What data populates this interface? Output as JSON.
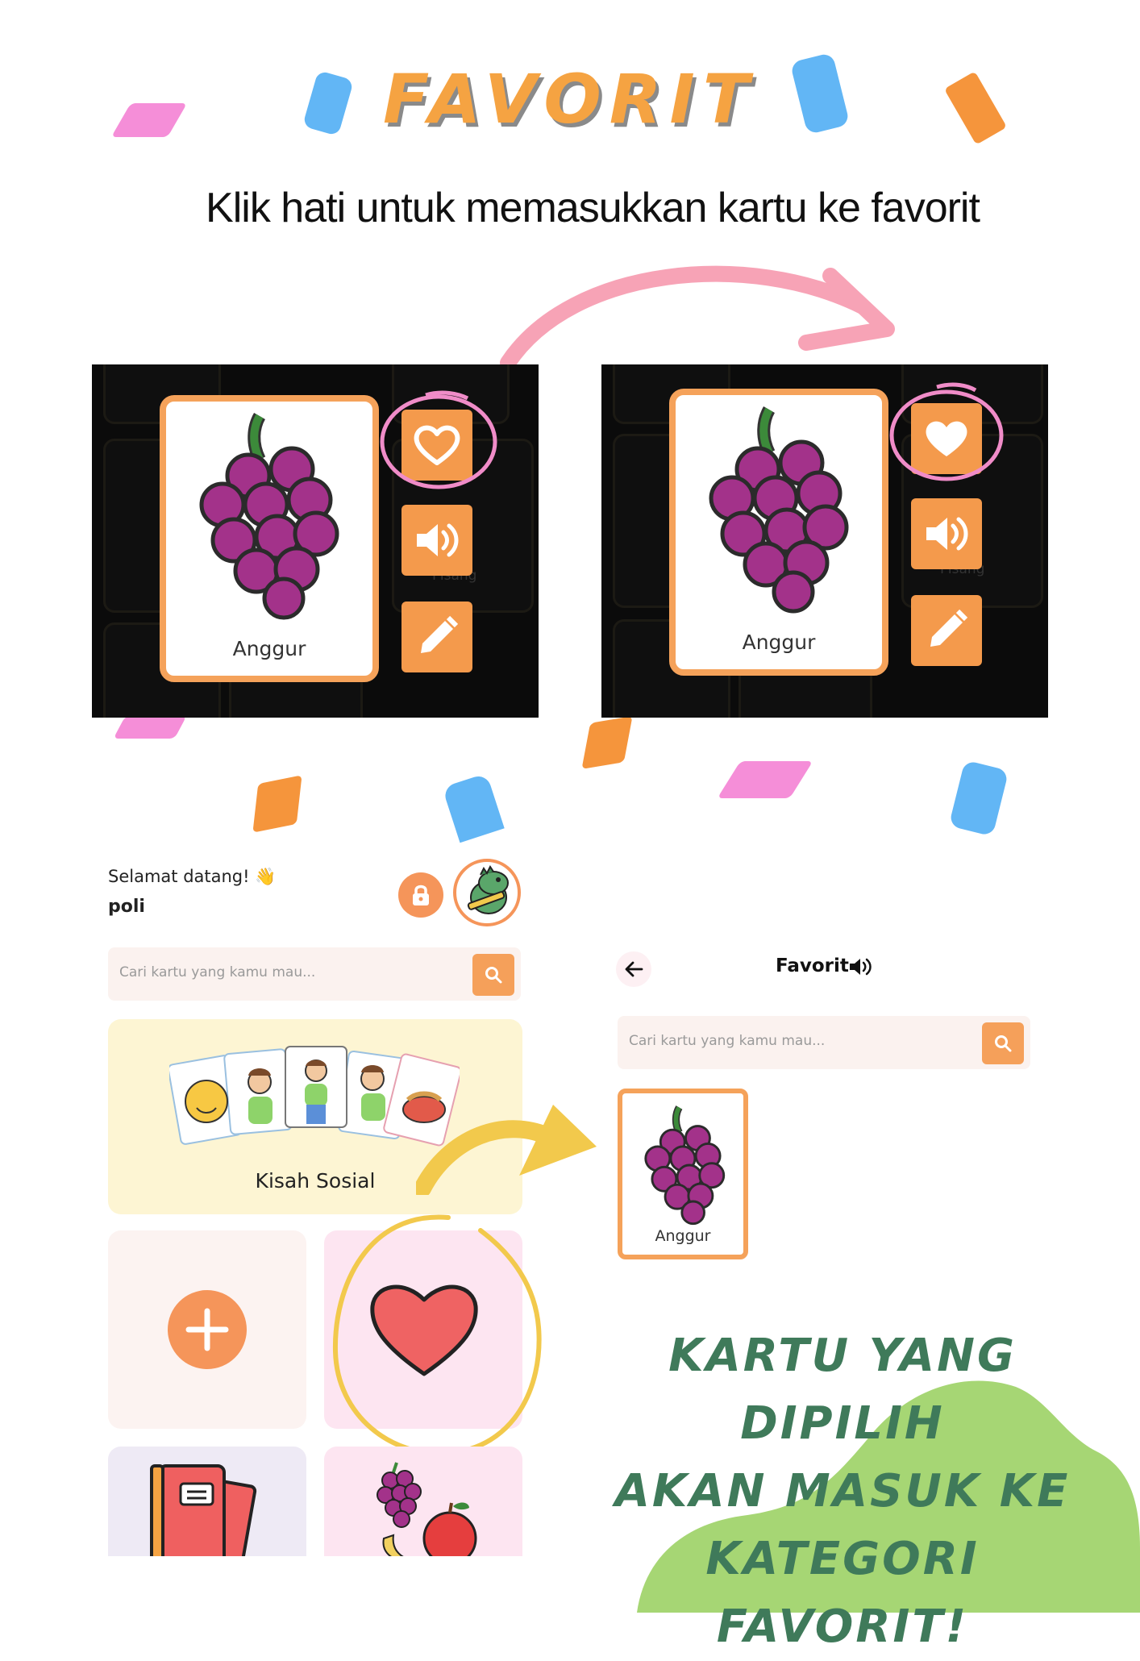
{
  "header": {
    "title": "FAVORIT",
    "subtitle": "Klik hati untuk memasukkan kartu ke favorit"
  },
  "step_cards": {
    "card_label": "Anggur",
    "ghost_labels": [
      "Pisang",
      "Pisang"
    ]
  },
  "home": {
    "greeting": "Selamat datang! 👋",
    "username": "poli",
    "search_placeholder": "Cari kartu yang kamu mau...",
    "social_story_label": "Kisah Sosial"
  },
  "favorites": {
    "header_title": "Favorit",
    "search_placeholder": "Cari kartu yang kamu mau...",
    "card_label": "Anggur"
  },
  "caption": {
    "lines": [
      "KARTU YANG DIPILIH",
      "AKAN MASUK KE",
      "KATEGORI FAVORIT!"
    ]
  },
  "colors": {
    "orange": "#f5a342",
    "pink": "#f5a3b8",
    "yellow": "#f2c94c",
    "green": "#a6d674",
    "dark_green": "#3f7a5a",
    "heart_red": "#ef6363"
  },
  "icons": [
    "heart-outline-icon",
    "heart-filled-icon",
    "speaker-icon",
    "pencil-icon",
    "lock-icon",
    "search-icon",
    "back-arrow-icon",
    "plus-icon"
  ]
}
